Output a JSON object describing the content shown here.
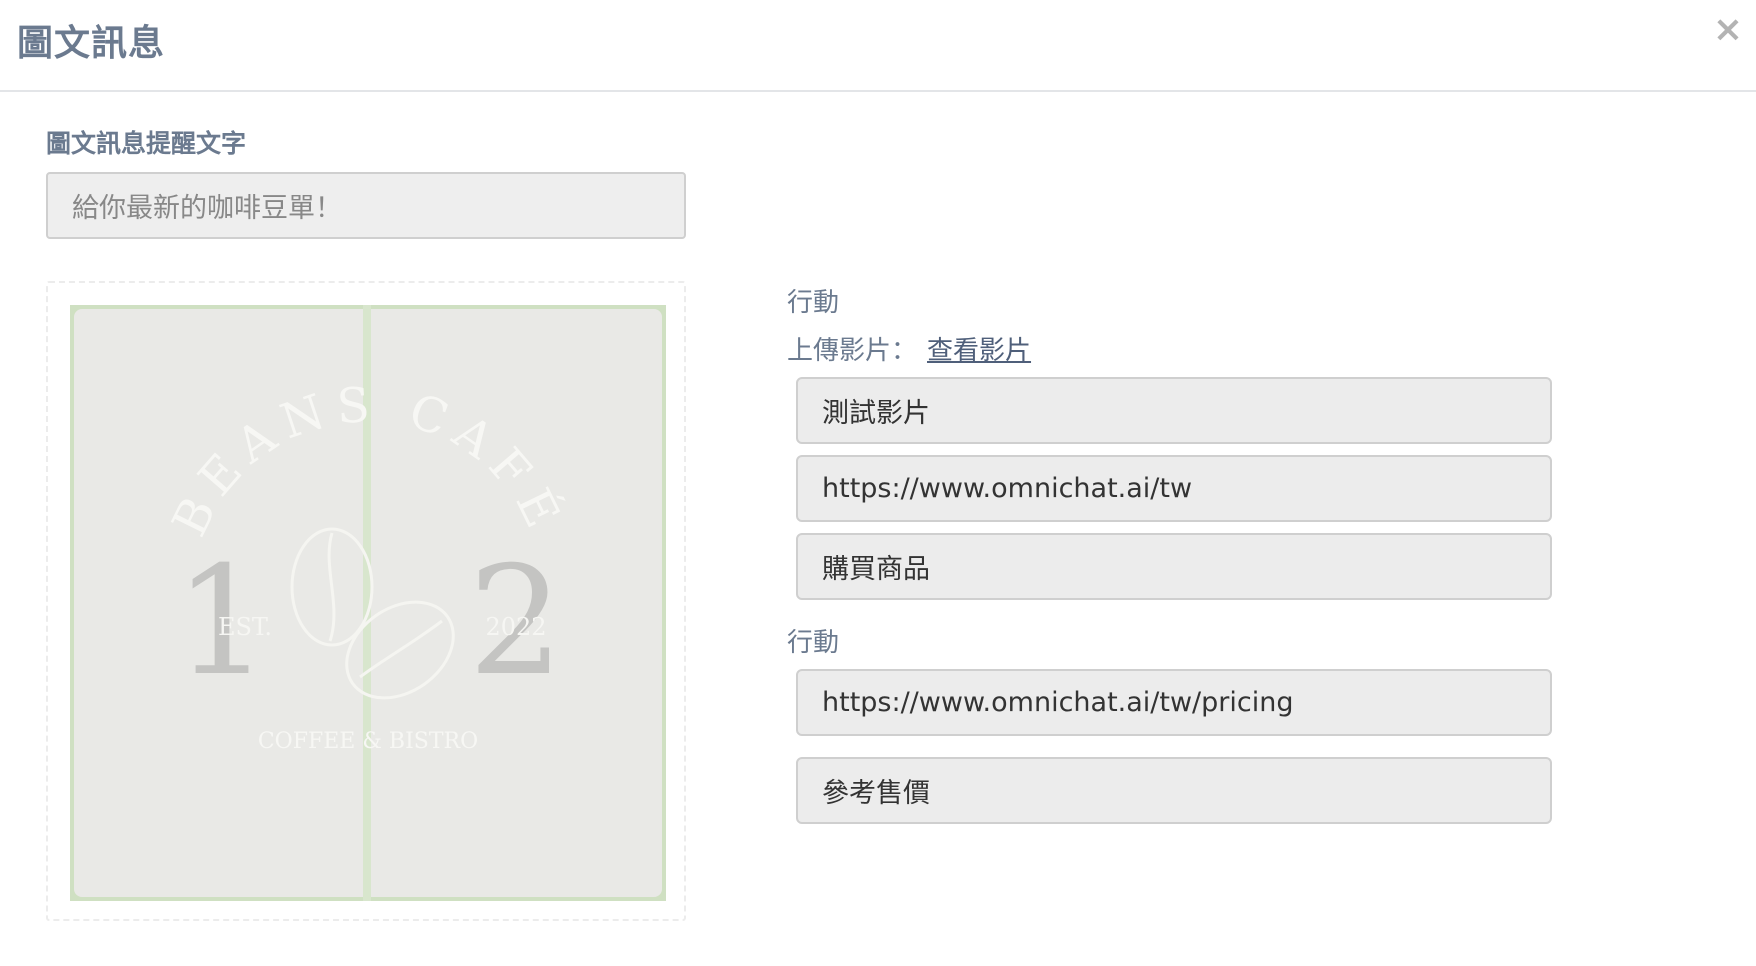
{
  "modal": {
    "title": "圖文訊息",
    "close_label": "×"
  },
  "alt_text": {
    "label": "圖文訊息提醒文字",
    "value": "給你最新的咖啡豆單！"
  },
  "image": {
    "logo_text": {
      "arc": "BEANS CAFÉ",
      "left_digit": "1",
      "right_digit": "2",
      "est": "EST.",
      "year": "2022",
      "tagline": "COFFEE & BISTRO"
    }
  },
  "actions": [
    {
      "label": "行動",
      "upload_label": "上傳影片：",
      "upload_link": "查看影片",
      "video_title": "測試影片",
      "url": "https://www.omnichat.ai/tw",
      "button_text": "購買商品"
    },
    {
      "label": "行動",
      "url": "https://www.omnichat.ai/tw/pricing",
      "button_text": "參考售價"
    }
  ],
  "colors": {
    "label": "#6b7a8f",
    "input_bg": "#eeeeee",
    "image_border": "#cfe0c2"
  }
}
